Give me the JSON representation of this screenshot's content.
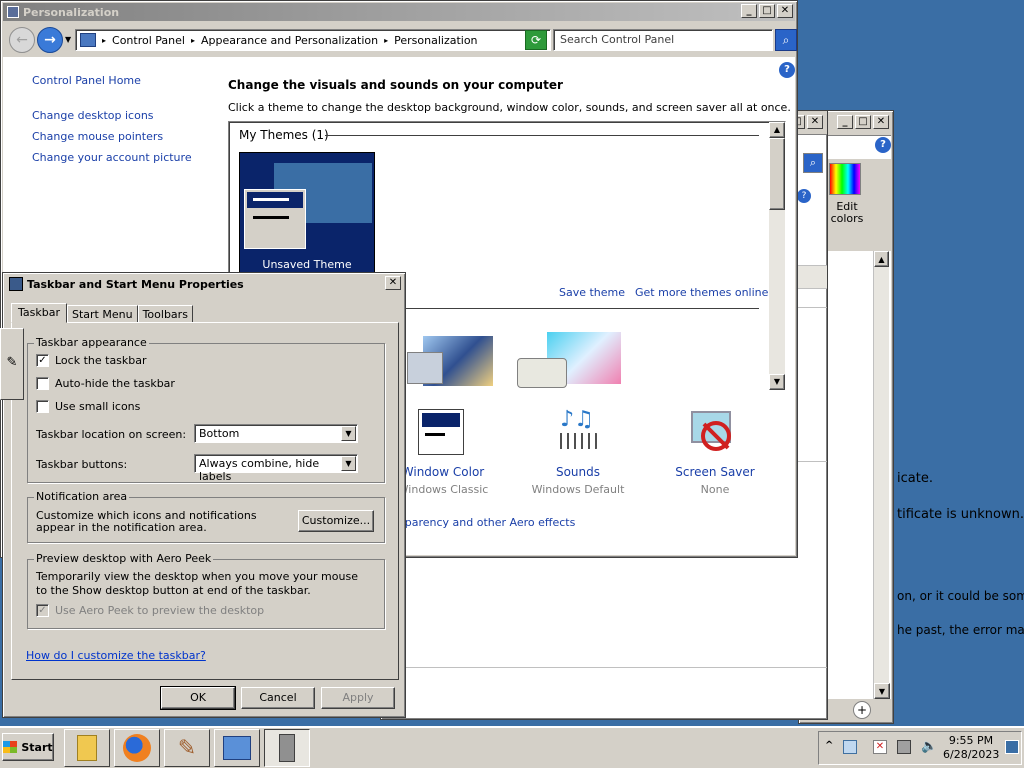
{
  "personalization": {
    "title": "Personalization",
    "breadcrumbs": [
      "Control Panel",
      "Appearance and Personalization",
      "Personalization"
    ],
    "search_placeholder": "Search Control Panel",
    "sidebar": {
      "home": "Control Panel Home",
      "links": [
        "Change desktop icons",
        "Change mouse pointers",
        "Change your account picture"
      ]
    },
    "heading": "Change the visuals and sounds on your computer",
    "subheading": "Click a theme to change the desktop background, window color, sounds, and screen saver all at once.",
    "my_themes_label": "My Themes (1)",
    "unsaved_theme_label": "Unsaved Theme",
    "save_theme": "Save theme",
    "get_more_themes": "Get more themes online",
    "bottom_items": [
      {
        "title": "Window Color",
        "subtitle": "Windows Classic"
      },
      {
        "title": "Sounds",
        "subtitle": "Windows Default"
      },
      {
        "title": "Screen Saver",
        "subtitle": "None"
      }
    ],
    "aero_link": "sparency and other Aero effects"
  },
  "background_window": {
    "edit_colors_line1": "Edit",
    "edit_colors_line2": "colors",
    "text_lines": [
      "icate.",
      "tificate is unknown.",
      "on, or it could be some",
      "he past, the error may"
    ]
  },
  "taskbar_dialog": {
    "title": "Taskbar and Start Menu Properties",
    "tabs": [
      "Taskbar",
      "Start Menu",
      "Toolbars"
    ],
    "appearance_group": "Taskbar appearance",
    "lock_taskbar": "Lock the taskbar",
    "auto_hide": "Auto-hide the taskbar",
    "small_icons": "Use small icons",
    "location_label": "Taskbar location on screen:",
    "location_value": "Bottom",
    "buttons_label": "Taskbar buttons:",
    "buttons_value": "Always combine, hide labels",
    "notification_group": "Notification area",
    "notification_text": "Customize which icons and notifications appear in the notification area.",
    "customize_button": "Customize...",
    "peek_group": "Preview desktop with Aero Peek",
    "peek_text": "Temporarily view the desktop when you move your mouse to the Show desktop button at end of the taskbar.",
    "peek_checkbox": "Use Aero Peek to preview the desktop",
    "help_link": "How do I customize the taskbar?",
    "ok": "OK",
    "cancel": "Cancel",
    "apply": "Apply",
    "state": {
      "lock_taskbar": true,
      "auto_hide": false,
      "small_icons": false,
      "aero_peek": true
    }
  },
  "taskbar": {
    "start_label": "Start",
    "time": "9:55 PM",
    "date": "6/28/2023"
  }
}
